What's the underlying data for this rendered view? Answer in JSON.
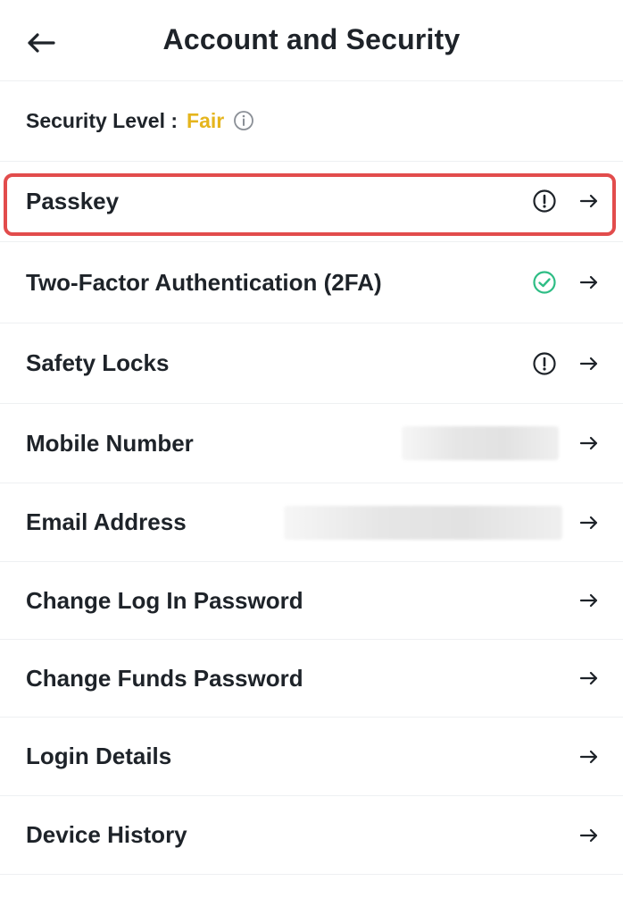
{
  "header": {
    "title": "Account and Security",
    "back_icon": "arrow-left-icon"
  },
  "security": {
    "label": "Security Level :",
    "value": "Fair",
    "value_color": "#e5b51d",
    "info_icon": "info-icon"
  },
  "menu": {
    "items": [
      {
        "label": "Passkey",
        "status": "warning",
        "status_icon": "alert-circle-icon"
      },
      {
        "label": "Two-Factor Authentication (2FA)",
        "status": "enabled",
        "status_icon": "check-circle-icon",
        "status_color": "#2ebd85"
      },
      {
        "label": "Safety Locks",
        "status": "warning",
        "status_icon": "alert-circle-icon"
      },
      {
        "label": "Mobile Number",
        "value_hidden": true
      },
      {
        "label": "Email Address",
        "value_hidden": true
      },
      {
        "label": "Change Log In Password"
      },
      {
        "label": "Change Funds Password"
      },
      {
        "label": "Login Details"
      },
      {
        "label": "Device History"
      }
    ],
    "arrow_icon": "arrow-right-icon"
  },
  "highlight": {
    "target": "Passkey",
    "color": "#e24c4c"
  }
}
